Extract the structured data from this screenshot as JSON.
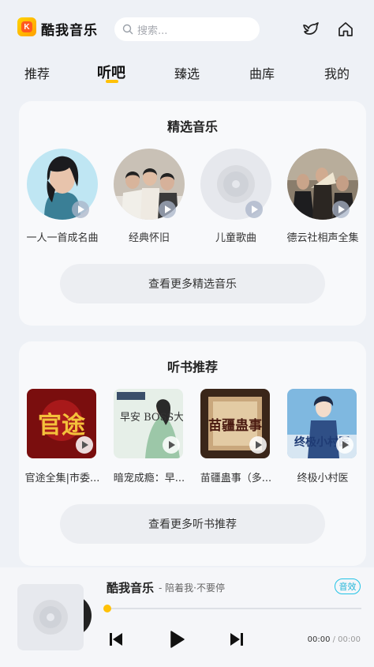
{
  "header": {
    "app_name": "酷我音乐",
    "logo_letter": "K",
    "search_placeholder": "搜索...",
    "icons": [
      "search-icon",
      "bird-icon",
      "home-icon"
    ]
  },
  "tabs": [
    {
      "label": "推荐",
      "active": false
    },
    {
      "label": "听吧",
      "active": true
    },
    {
      "label": "臻选",
      "active": false
    },
    {
      "label": "曲库",
      "active": false
    },
    {
      "label": "我的",
      "active": false
    }
  ],
  "featured": {
    "title": "精选音乐",
    "items": [
      {
        "label": "一人一首成名曲"
      },
      {
        "label": "经典怀旧"
      },
      {
        "label": "儿童歌曲"
      },
      {
        "label": "德云社相声全集"
      }
    ],
    "more_label": "查看更多精选音乐"
  },
  "books": {
    "title": "听书推荐",
    "items": [
      {
        "label": "官途全集|市委...",
        "cover_text": "官途"
      },
      {
        "label": "暗宠成瘾：早...",
        "cover_text": "早安 BOSS大人"
      },
      {
        "label": "苗疆蛊事（多...",
        "cover_text": "苗疆蛊事"
      },
      {
        "label": "终极小村医",
        "cover_text": "终极小村医"
      }
    ],
    "more_label": "查看更多听书推荐"
  },
  "player": {
    "title": "酷我音乐",
    "subtitle": "- 陪着我·不要停",
    "badge": "音效",
    "progress": 0.0,
    "current_time": "00:00",
    "separator": " / ",
    "duration": "00:00",
    "accent_color": "#ffc107"
  }
}
